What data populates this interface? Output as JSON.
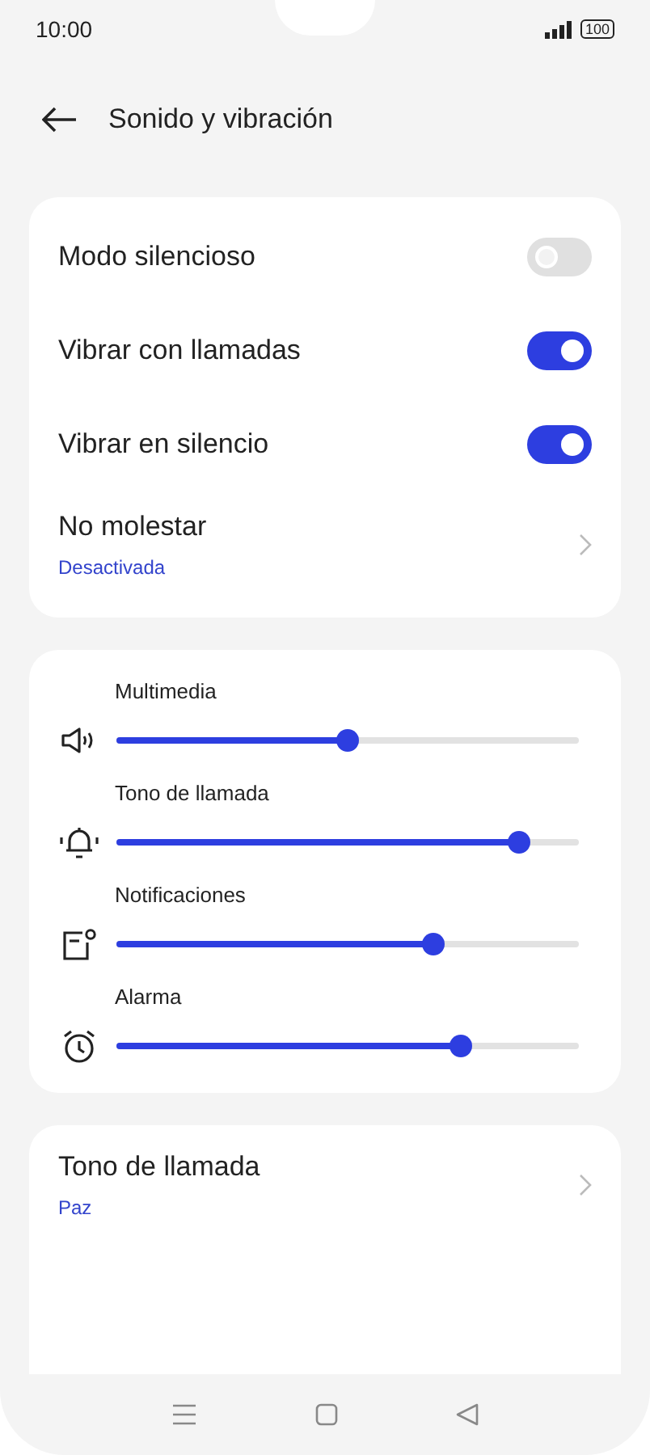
{
  "status_bar": {
    "time": "10:00",
    "battery": "100"
  },
  "header": {
    "title": "Sonido y vibración"
  },
  "toggles": [
    {
      "label": "Modo silencioso",
      "on": false
    },
    {
      "label": "Vibrar con llamadas",
      "on": true
    },
    {
      "label": "Vibrar en silencio",
      "on": true
    }
  ],
  "do_not_disturb": {
    "label": "No molestar",
    "value": "Desactivada"
  },
  "volumes": [
    {
      "kind": "media",
      "label": "Multimedia",
      "level": 0.5
    },
    {
      "kind": "ringtone",
      "label": "Tono de llamada",
      "level": 0.87
    },
    {
      "kind": "notification",
      "label": "Notificaciones",
      "level": 0.685
    },
    {
      "kind": "alarm",
      "label": "Alarma",
      "level": 0.745
    }
  ],
  "ringtone": {
    "label": "Tono de llamada",
    "value": "Paz"
  }
}
